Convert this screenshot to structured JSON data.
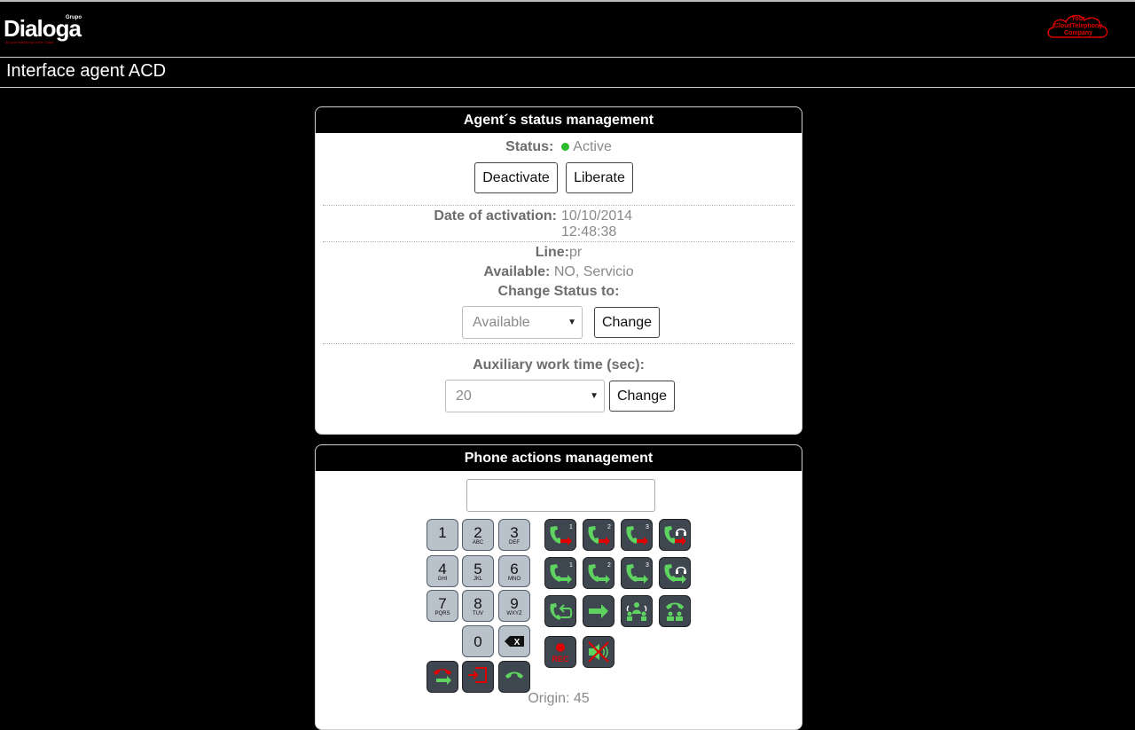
{
  "header": {
    "logo_text": "Dialoga",
    "logo_super": "Grupo",
    "logo_tagline": "All your telephony in the Cloud",
    "brand_badge": [
      "Your",
      "CloudTelephony",
      "Company"
    ],
    "page_title": "Interface agent ACD"
  },
  "status_panel": {
    "title": "Agent´s status management",
    "status_label": "Status:",
    "status_value": "Active",
    "status_color": "#2bbd2b",
    "deactivate_label": "Deactivate",
    "liberate_label": "Liberate",
    "activation_label": "Date of activation:",
    "activation_date": "10/10/2014",
    "activation_time": "12:48:38",
    "line_label": "Line:",
    "line_value": "pr",
    "available_label": "Available:",
    "available_value": "NO, Servicio",
    "change_status_label": "Change Status to:",
    "status_select_value": "Available",
    "change_label": "Change",
    "aux_label": "Auxiliary work time (sec):",
    "aux_select_value": "20",
    "aux_change_label": "Change"
  },
  "phone_panel": {
    "title": "Phone actions management",
    "number_value": "",
    "keys": [
      {
        "d": "1",
        "l": ""
      },
      {
        "d": "2",
        "l": "ABC"
      },
      {
        "d": "3",
        "l": "DEF"
      },
      {
        "d": "4",
        "l": "GHI"
      },
      {
        "d": "5",
        "l": "JKL"
      },
      {
        "d": "6",
        "l": "MNO"
      },
      {
        "d": "7",
        "l": "PQRS"
      },
      {
        "d": "8",
        "l": "TUV"
      },
      {
        "d": "9",
        "l": "WXYZ"
      },
      {
        "d": "0",
        "l": ""
      }
    ],
    "backspace_glyph": "X",
    "rec_label": "REC",
    "line_numbers": [
      "1",
      "2",
      "3"
    ],
    "origin_label": "Origin: 45"
  },
  "colors": {
    "accent_red": "#e00000",
    "phone_green": "#5fd35f",
    "action_bg": "#3e4650",
    "key_bg": "#b9c1cb"
  }
}
